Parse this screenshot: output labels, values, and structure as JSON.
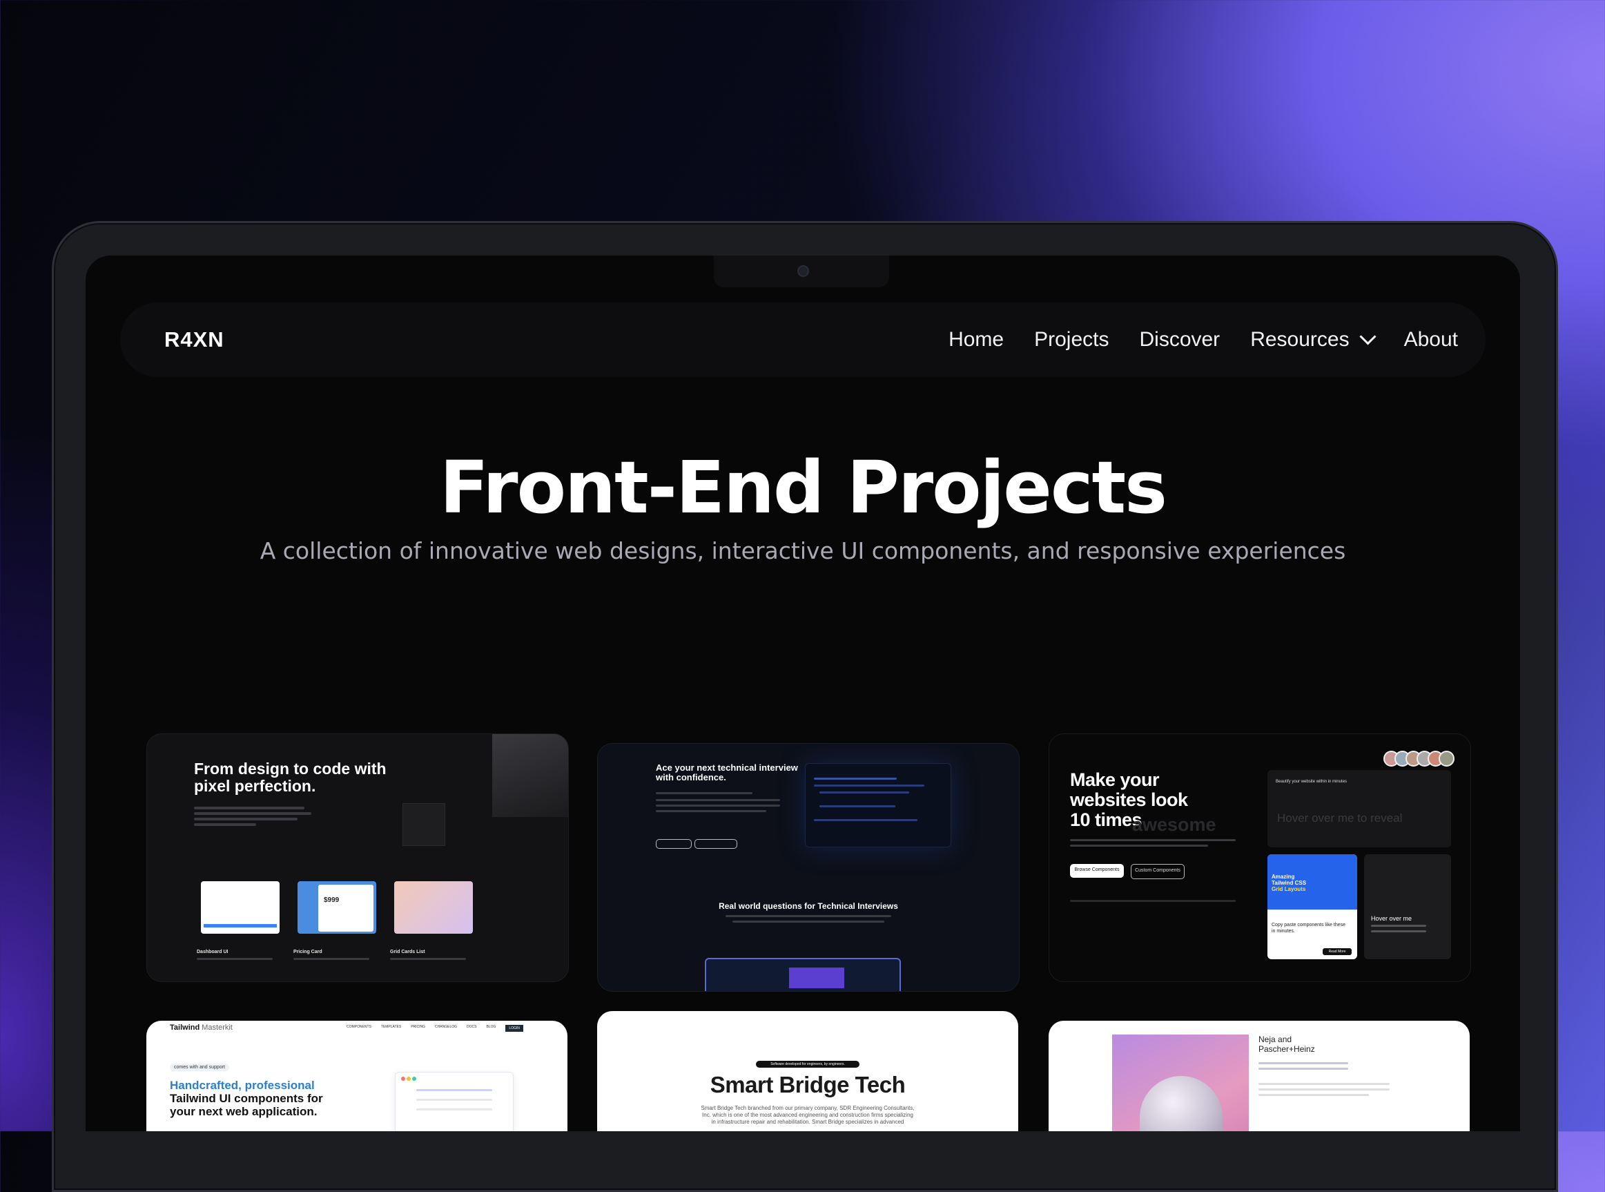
{
  "nav": {
    "logo": "R4XN",
    "links": [
      "Home",
      "Projects",
      "Discover",
      "Resources",
      "About"
    ]
  },
  "hero": {
    "title": "Front-End Projects",
    "subtitle": "A collection of innovative web designs, interactive UI components, and responsive experiences"
  },
  "projects": {
    "design_to_code": {
      "heading_line1": "From design to code with",
      "heading_line2": "pixel perfection.",
      "items": [
        "Dashboard UI",
        "Pricing Card",
        "Grid Cards List"
      ],
      "price": "$999"
    },
    "interview": {
      "heading_line1": "Ace your next technical interview",
      "heading_line2": "with confidence.",
      "section": "Real world questions for Technical Interviews"
    },
    "websites": {
      "heading_line1": "Make your",
      "heading_line2": "websites look",
      "heading_line3": "10 times",
      "ghost_word": "awesome",
      "tagline": "Beautify your website within in minutes",
      "hover_reveal": "Hover over me to reveal",
      "buttons": [
        "Browse Components",
        "Custom Components"
      ],
      "amazing": [
        "Amazing",
        "Tailwind CSS",
        "Grid Layouts"
      ],
      "copy_paste": "Copy paste components like these in minutes.",
      "read_more": "Read More",
      "hover_me": "Hover over me"
    },
    "tailwind": {
      "brand": "Tailwind",
      "brand_suffix": "Masterkit",
      "menu": [
        "COMPONENTS",
        "TEMPLATES",
        "PRICING",
        "CHANGELOG",
        "DOCS",
        "BLOG",
        "LOGIN"
      ],
      "badge": "comes with",
      "badge_support": "and",
      "badge_tail": "support",
      "headline_blue": "Handcrafted, professional",
      "headline_1": "Tailwind UI components for",
      "headline_2": "your next web application."
    },
    "smartbridge": {
      "pill": "Software developed for engineers, by engineers.",
      "title": "Smart Bridge Tech",
      "desc": "Smart Bridge Tech branched from our primary company, SDR Engineering Consultants, Inc. which is one of the most advanced engineering and construction firms specializing in infrastructure repair and rehabilitation. Smart Bridge specializes in advanced"
    },
    "neja": {
      "title_line1": "Neja and",
      "title_line2": "Pascher+Heinz"
    }
  },
  "colors": {
    "accent_blue": "#2563eb",
    "tailwind_blue": "#2a7fd1"
  }
}
